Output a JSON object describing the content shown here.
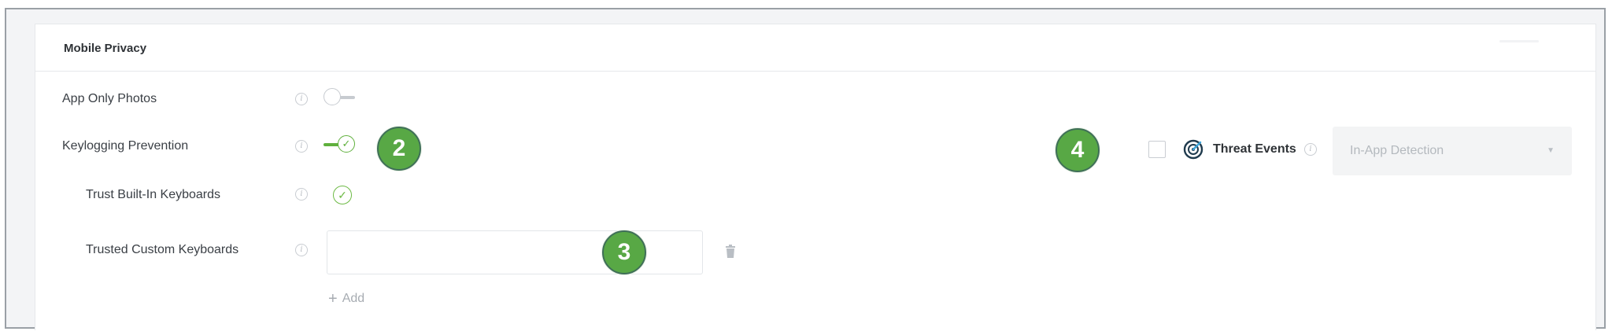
{
  "panel": {
    "title": "Mobile Privacy"
  },
  "rows": {
    "app_only_photos": {
      "label": "App Only Photos",
      "enabled": false
    },
    "keylogging_prevention": {
      "label": "Keylogging Prevention",
      "enabled": true
    },
    "trust_builtin_keyboards": {
      "label": "Trust Built-In Keyboards",
      "checked": true
    },
    "trusted_custom_keyboards": {
      "label": "Trusted Custom Keyboards",
      "value": "",
      "add_label": "Add"
    }
  },
  "threat": {
    "label": "Threat Events",
    "checked": false,
    "select_value": "In-App Detection"
  },
  "badges": [
    "2",
    "3",
    "4"
  ],
  "icons": {
    "info": "info-icon",
    "toggle_check": "checkmark-icon",
    "trash": "trash-icon",
    "add": "plus-icon",
    "threat": "radar-target-icon",
    "caret": "chevron-down-icon"
  },
  "colors": {
    "accent_green": "#5fb03c",
    "badge_green": "#58a845",
    "muted": "#c7cbd0"
  }
}
